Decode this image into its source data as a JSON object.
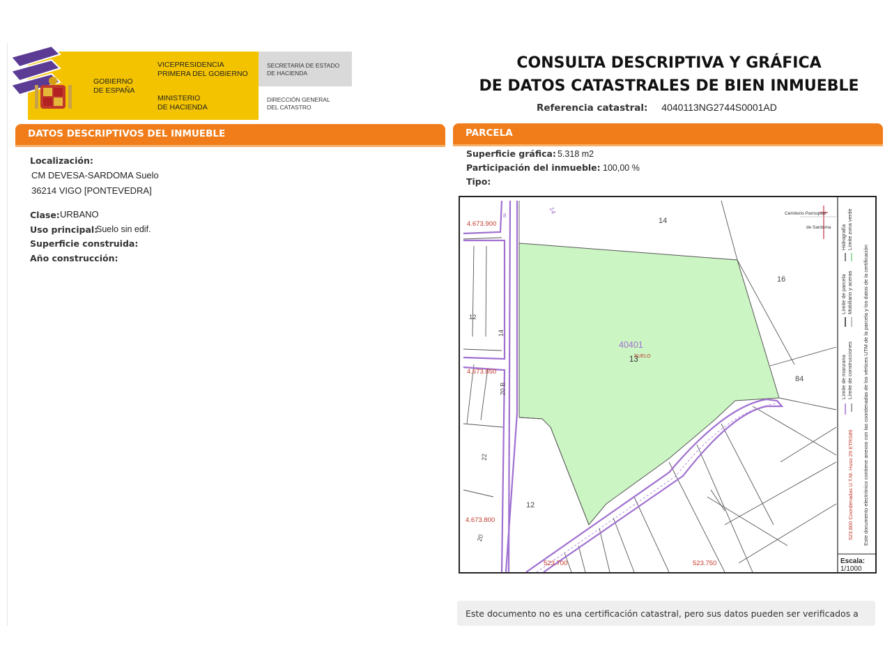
{
  "header": {
    "gov_line": "Gobierno\nde España",
    "vice_line": "Vicepresidencia\nPrimera del Gobierno",
    "ministry_line": "Ministerio\nde Hacienda",
    "secretaria_line": "Secretaría de Estado\nde Hacienda",
    "direccion_line": "Dirección General\ndel Catastro"
  },
  "title": {
    "line1": "CONSULTA DESCRIPTIVA Y GRÁFICA",
    "line2": "DE DATOS CATASTRALES DE BIEN INMUEBLE",
    "ref_label": "Referencia catastral:",
    "ref_value": "4040113NG2744S0001AD"
  },
  "left_section": {
    "heading": "DATOS DESCRIPTIVOS DEL INMUEBLE",
    "localizacion_label": "Localización:",
    "address_line1": "CM DEVESA-SARDOMA  Suelo",
    "address_line2": "36214 VIGO [PONTEVEDRA]",
    "clase_label": "Clase:",
    "clase_value": "URBANO",
    "uso_label": "Uso principal:",
    "uso_value": "Suelo sin edif.",
    "superficie_label": "Superficie construida:",
    "ano_label": "Año construcción:"
  },
  "right_section": {
    "heading": "PARCELA",
    "superficie_label": "Superficie gráfica:",
    "superficie_value": "5.318 m2",
    "participacion_label": "Participación del inmueble:",
    "participacion_value": "100,00 %",
    "tipo_label": "Tipo:"
  },
  "map": {
    "parcel_id": "40401",
    "parcel_num": "13",
    "suelo_label": "SUELO",
    "labels": {
      "n14_top": "14",
      "n14_road": "14",
      "n16": "16",
      "n84": "84",
      "n12_left": "12",
      "n12_bottom": "12",
      "n14_vertical": "14",
      "n20b": "20 B",
      "n22": "22",
      "n20": "20",
      "n8": "8",
      "cemetery_1": "Cemiterio Parroquial",
      "cemetery_2": "de Sardoma"
    },
    "coords": {
      "y_top": "4.673.900",
      "y_mid": "4.673.850",
      "y_bottom": "4.673.800",
      "x_left": "523.700",
      "x_right": "523.750"
    },
    "legend": {
      "manzana": "Límite de manzana",
      "construcciones": "Límite de construcciones",
      "parcela": "Límite de parcela",
      "mobiliario": "Mobiliario y aceras",
      "hidrografia": "Hidrografía",
      "zona_verde": "Límite zona verde",
      "coords_note": "523.800 Coordenadas U.T.M. Huso 29 ETRS89",
      "doc_note": "Este documento electrónico contiene anexos con las coordenadas de los vértices UTM de la parcela y los datos de la certificación"
    },
    "scale_label": "Escala:",
    "scale_value": "1/1000"
  },
  "footer_note": "Este documento no es una certificación catastral, pero sus datos pueden ser verificados a",
  "colors": {
    "orange": "#f07d1a",
    "yellow": "#f4c300",
    "parcel_green": "#ccf5c4",
    "boundary_purple": "#a070d0"
  }
}
